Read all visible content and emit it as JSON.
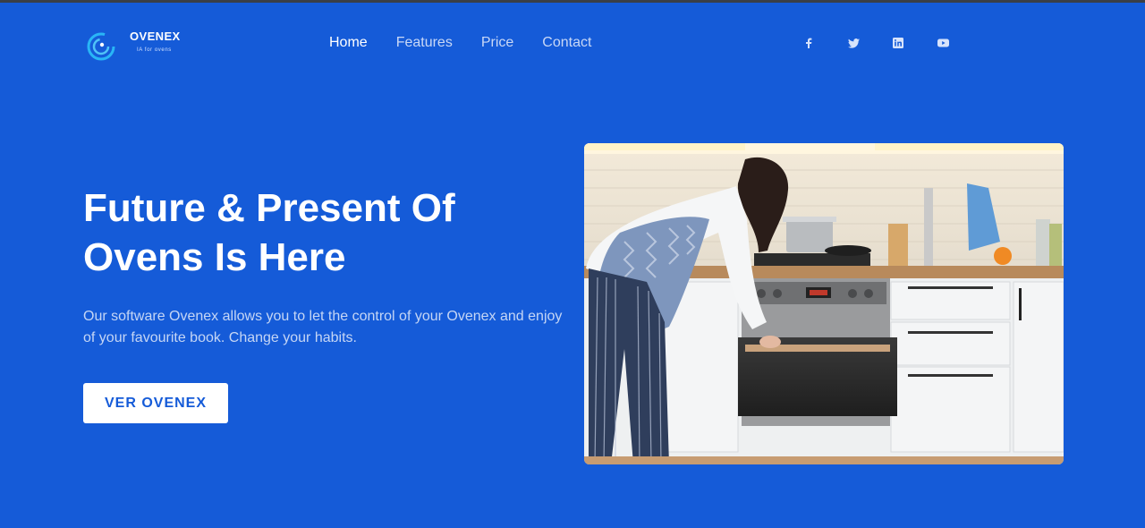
{
  "brand": {
    "name": "OVENEX",
    "tagline": "IA for ovens",
    "logo_icon": "ovenex-logo-icon",
    "accent": "#155bd8"
  },
  "nav": {
    "items": [
      {
        "label": "Home",
        "active": true
      },
      {
        "label": "Features",
        "active": false
      },
      {
        "label": "Price",
        "active": false
      },
      {
        "label": "Contact",
        "active": false
      }
    ]
  },
  "social": {
    "icons": [
      "facebook-icon",
      "twitter-icon",
      "linkedin-icon",
      "youtube-icon"
    ]
  },
  "hero": {
    "title_line1": "Future & Present Of",
    "title_line2": "Ovens Is Here",
    "text": "Our software Ovenex allows you to let the control of your Ovenex and enjoy of your favourite book. Change your habits.",
    "button_label": "VER OVENEX",
    "image_alt": "Woman opening an oven in a white kitchen"
  },
  "colors": {
    "background": "#155bd8",
    "text_white": "#ffffff",
    "text_muted": "#c5d6f5"
  }
}
